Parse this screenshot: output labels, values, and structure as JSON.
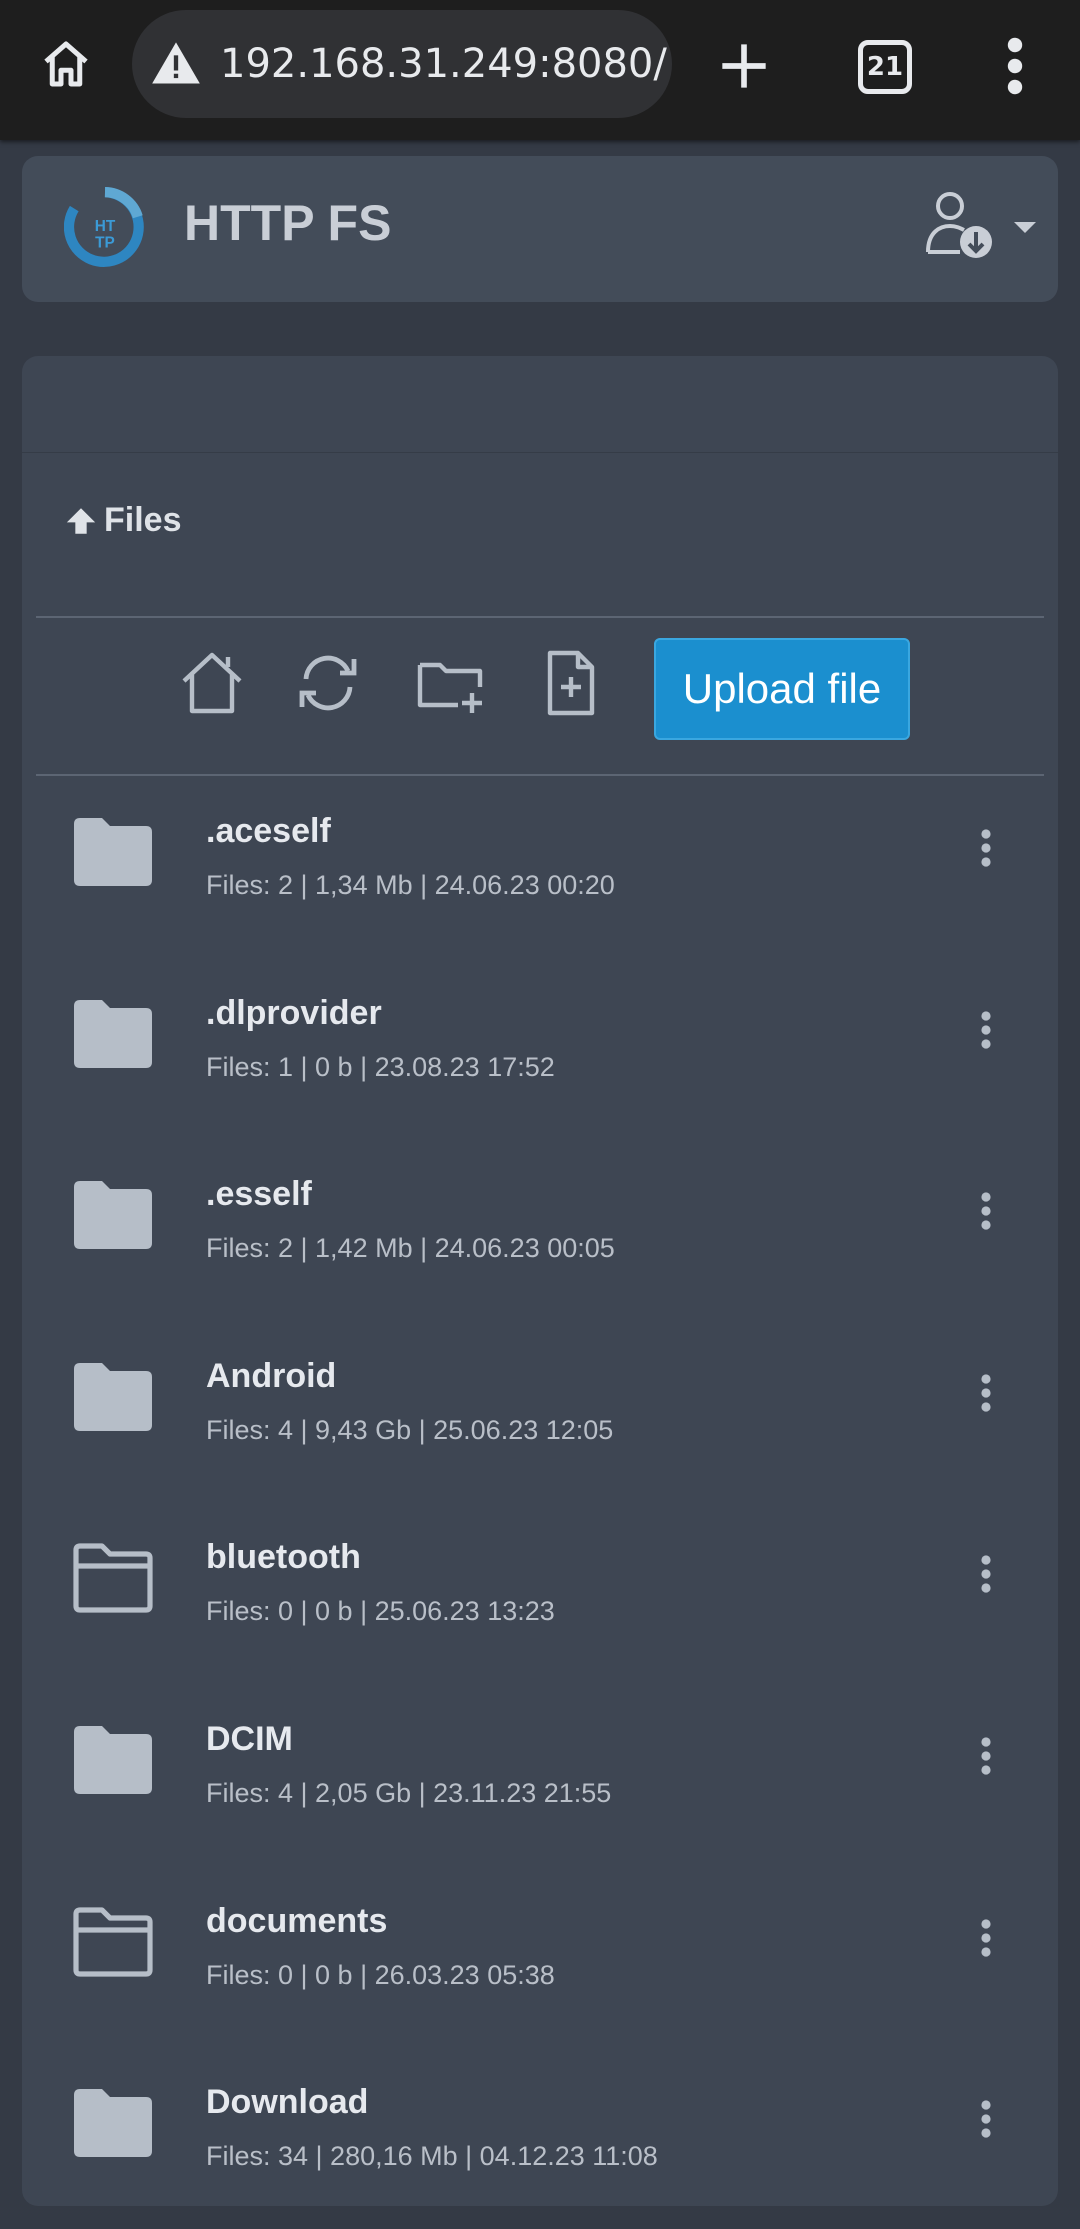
{
  "browser": {
    "url": "192.168.31.249:8080/",
    "tab_count": "21"
  },
  "header": {
    "logo_text": "HTTP",
    "title": "HTTP FS"
  },
  "breadcrumb": {
    "label": "Files"
  },
  "toolbar": {
    "upload_label": "Upload file"
  },
  "files": [
    {
      "name": ".aceself",
      "meta": "Files: 2 | 1,34 Mb | 24.06.23 00:20",
      "empty": false
    },
    {
      "name": ".dlprovider",
      "meta": "Files: 1 | 0 b | 23.08.23 17:52",
      "empty": false
    },
    {
      "name": ".esself",
      "meta": "Files: 2 | 1,42 Mb | 24.06.23 00:05",
      "empty": false
    },
    {
      "name": "Android",
      "meta": "Files: 4 | 9,43 Gb | 25.06.23 12:05",
      "empty": false
    },
    {
      "name": "bluetooth",
      "meta": "Files: 0 | 0 b | 25.06.23 13:23",
      "empty": true
    },
    {
      "name": "DCIM",
      "meta": "Files: 4 | 2,05 Gb | 23.11.23 21:55",
      "empty": false
    },
    {
      "name": "documents",
      "meta": "Files: 0 | 0 b | 26.03.23 05:38",
      "empty": true
    },
    {
      "name": "Download",
      "meta": "Files: 34 | 280,16 Mb | 04.12.23 11:08",
      "empty": false
    }
  ],
  "colors": {
    "accent": "#1b8fcf",
    "background": "#343a45",
    "card": "#3e4653",
    "folder": "#b6bec8"
  }
}
